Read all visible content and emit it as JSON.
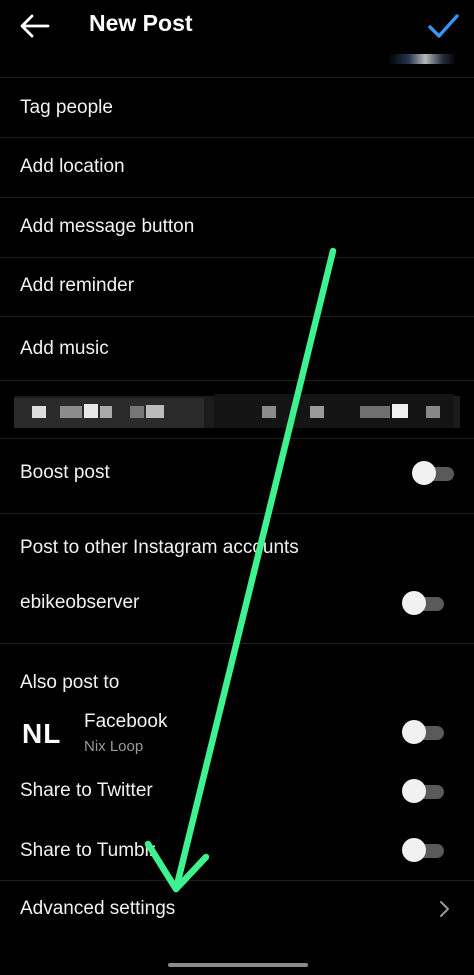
{
  "header": {
    "title": "New Post",
    "back_icon": "arrow-left-icon",
    "confirm_icon": "checkmark-icon",
    "accent_color": "#3897f0"
  },
  "options": {
    "tag_people": "Tag people",
    "add_location": "Add location",
    "add_message_button": "Add message button",
    "add_reminder": "Add reminder",
    "add_music": "Add music"
  },
  "boost": {
    "label": "Boost post",
    "enabled": false
  },
  "other_accounts": {
    "heading": "Post to other Instagram accounts",
    "account_name": "ebikeobserver",
    "enabled": false
  },
  "also_post": {
    "heading": "Also post to",
    "facebook": {
      "logo_text": "NL",
      "label": "Facebook",
      "page_name": "Nix Loop",
      "enabled": false
    },
    "twitter": {
      "label": "Share to Twitter",
      "enabled": false
    },
    "tumblr": {
      "label": "Share to Tumblr",
      "enabled": false
    }
  },
  "advanced": {
    "label": "Advanced settings",
    "chevron_icon": "chevron-right-icon"
  },
  "annotation": {
    "arrow_color": "#3ef28f"
  }
}
